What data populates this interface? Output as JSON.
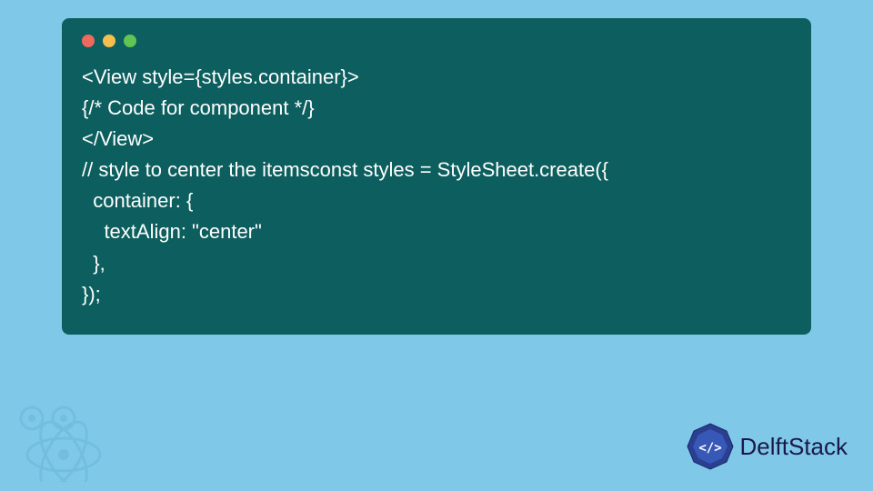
{
  "code": {
    "line1": "<View style={styles.container}>",
    "line2": "{/* Code for component */}",
    "line3": "</View>",
    "line4": "// style to center the itemsconst styles = StyleSheet.create({",
    "line5": "  container: {",
    "line6": "    textAlign: \"center\"",
    "line7": "  },",
    "line8": "});"
  },
  "brand": {
    "name": "DelftStack"
  }
}
